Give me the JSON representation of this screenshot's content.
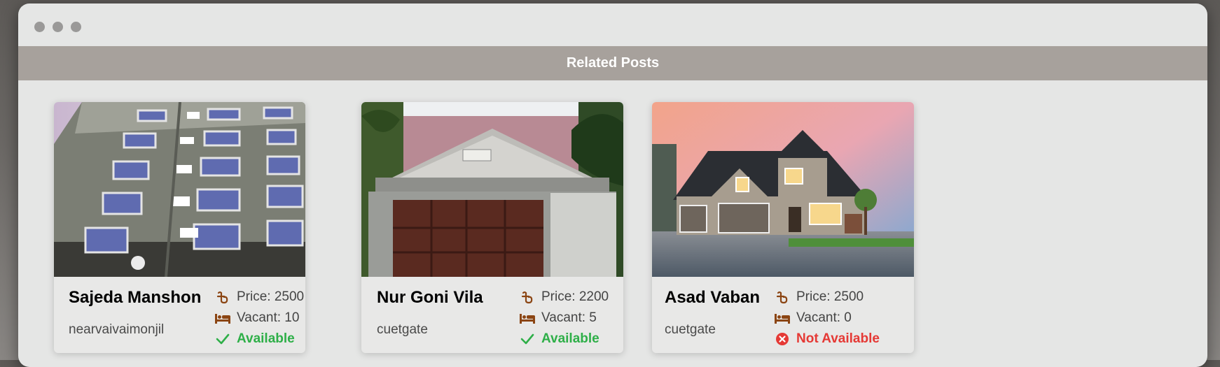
{
  "window": {
    "title": ""
  },
  "section": {
    "title": "Related Posts"
  },
  "posts": [
    {
      "name": "Sajeda Manshon",
      "location": "nearvaivaimonjil",
      "price": "Price: 2500",
      "vacant": "Vacant: 10",
      "status": "Available",
      "available": true
    },
    {
      "name": "Nur Goni Vila",
      "location": "cuetgate",
      "price": "Price: 2200",
      "vacant": "Vacant: 5",
      "status": "Available",
      "available": true
    },
    {
      "name": "Asad Vaban",
      "location": "cuetgate",
      "price": "Price: 2500",
      "vacant": "Vacant: 0",
      "status": "Not Available",
      "available": false
    }
  ],
  "icons": {
    "price": "taka-icon",
    "vacant": "bed-icon",
    "available": "check-icon",
    "not_available": "x-circle-icon"
  },
  "colors": {
    "accent": "#8b4513",
    "available": "#2eaf48",
    "not_available": "#e53935",
    "header": "#a7a19c"
  }
}
